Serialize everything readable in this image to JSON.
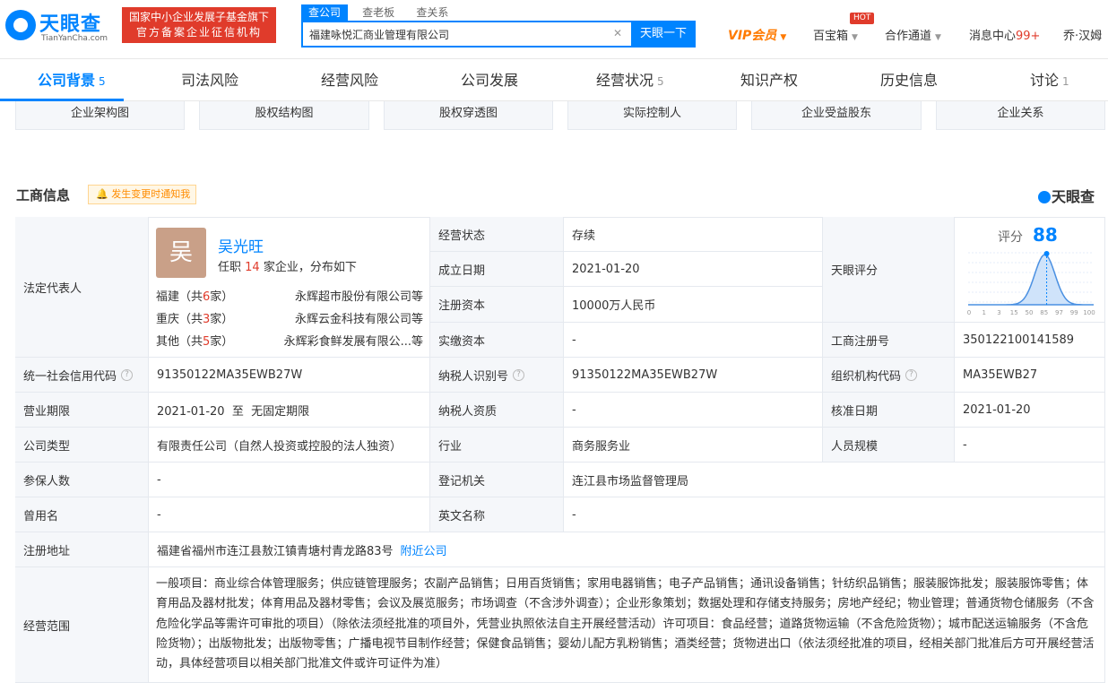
{
  "header": {
    "logo_cn": "天眼查",
    "logo_en": "TianYanCha.com",
    "badge_line1": "国家中小企业发展子基金旗下",
    "badge_line2": "官方备案企业征信机构",
    "search_tabs": [
      "查公司",
      "查老板",
      "查关系"
    ],
    "search_value": "福建咏悦汇商业管理有限公司",
    "search_button": "天眼一下",
    "vip": "VIP会员",
    "treasure": "百宝箱",
    "hot": "HOT",
    "cooperate": "合作通道",
    "messages": "消息中心",
    "message_count": "99+",
    "user": "乔·汉姆"
  },
  "tabs": [
    {
      "label": "公司背景",
      "count": "5"
    },
    {
      "label": "司法风险",
      "count": ""
    },
    {
      "label": "经营风险",
      "count": ""
    },
    {
      "label": "公司发展",
      "count": ""
    },
    {
      "label": "经营状况",
      "count": "5"
    },
    {
      "label": "知识产权",
      "count": ""
    },
    {
      "label": "历史信息",
      "count": ""
    },
    {
      "label": "讨论",
      "count": "1"
    }
  ],
  "subbuttons": [
    "企业架构图",
    "股权结构图",
    "股权穿透图",
    "实际控制人",
    "企业受益股东",
    "企业关系"
  ],
  "section": {
    "title": "工商信息",
    "notify": "发生变更时通知我",
    "brand": "天眼查"
  },
  "legal_rep": {
    "label": "法定代表人",
    "avatar_char": "吴",
    "name": "吴光旺",
    "sub_prefix": "任职",
    "sub_count": "14",
    "sub_suffix": "家企业，分布如下",
    "provinces": [
      {
        "prov": "福建（共",
        "n": "6",
        "unit": "家）",
        "company": "永辉超市股份有限公司等"
      },
      {
        "prov": "重庆（共",
        "n": "3",
        "unit": "家）",
        "company": "永辉云金科技有限公司等"
      },
      {
        "prov": "其他（共",
        "n": "5",
        "unit": "家）",
        "company": "永辉彩食鲜发展有限公...等"
      }
    ]
  },
  "fields": {
    "status_label": "经营状态",
    "status": "存续",
    "founded_label": "成立日期",
    "founded": "2021-01-20",
    "reg_cap_label": "注册资本",
    "reg_cap": "10000万人民币",
    "paid_cap_label": "实缴资本",
    "paid_cap": "-",
    "score_label": "天眼评分",
    "reg_no_label": "工商注册号",
    "reg_no": "350122100141589",
    "credit_label": "统一社会信用代码",
    "credit": "91350122MA35EWB27W",
    "taxid_label": "纳税人识别号",
    "taxid": "91350122MA35EWB27W",
    "org_label": "组织机构代码",
    "org": "MA35EWB27",
    "term_label": "营业期限",
    "term": "2021-01-20  至  无固定期限",
    "tax_qual_label": "纳税人资质",
    "tax_qual": "-",
    "approve_label": "核准日期",
    "approve": "2021-01-20",
    "type_label": "公司类型",
    "type": "有限责任公司（自然人投资或控股的法人独资）",
    "industry_label": "行业",
    "industry": "商务服务业",
    "staff_label": "人员规模",
    "staff": "-",
    "insured_label": "参保人数",
    "insured": "-",
    "authority_label": "登记机关",
    "authority": "连江县市场监督管理局",
    "former_label": "曾用名",
    "former": "-",
    "english_label": "英文名称",
    "english": "-",
    "address_label": "注册地址",
    "address": "福建省福州市连江县敖江镇青塘村青龙路83号",
    "nearby": "附近公司",
    "scope_label": "经营范围",
    "scope": "一般项目：商业综合体管理服务；供应链管理服务；农副产品销售；日用百货销售；家用电器销售；电子产品销售；通讯设备销售；针纺织品销售；服装服饰批发；服装服饰零售；体育用品及器材批发；体育用品及器材零售；会议及展览服务；市场调查（不含涉外调查）；企业形象策划；数据处理和存储支持服务；房地产经纪；物业管理；普通货物仓储服务（不含危险化学品等需许可审批的项目）（除依法须经批准的项目外，凭营业执照依法自主开展经营活动）许可项目：食品经营；道路货物运输（不含危险货物）；城市配送运输服务（不含危险货物）；出版物批发；出版物零售；广播电视节目制作经营；保健食品销售；婴幼儿配方乳粉销售；酒类经营；货物进出口（依法须经批准的项目，经相关部门批准后方可开展经营活动，具体经营项目以相关部门批准文件或许可证件为准）"
  },
  "score": {
    "label": "评分",
    "value": 88,
    "ticks": [
      "0",
      "1",
      "3",
      "15",
      "50",
      "85",
      "97",
      "99",
      "100"
    ]
  }
}
